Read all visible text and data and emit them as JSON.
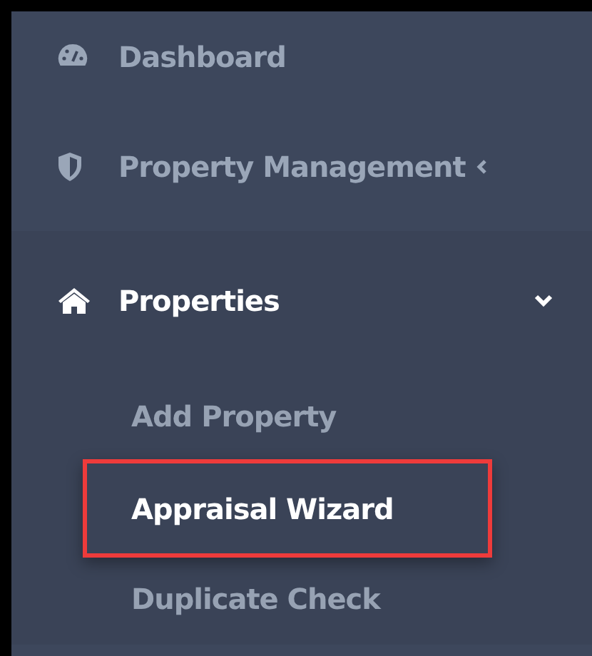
{
  "sidebar": {
    "items": [
      {
        "kind": "link",
        "label": "Dashboard",
        "selected": false
      },
      {
        "kind": "group",
        "label": "Property Management",
        "selected": false,
        "expanded": false
      },
      {
        "kind": "group",
        "label": "Properties",
        "selected": true,
        "expanded": true,
        "children": [
          {
            "label": "Add Property",
            "selected": false,
            "highlighted": false
          },
          {
            "label": "Appraisal Wizard",
            "selected": true,
            "highlighted": true
          },
          {
            "label": "Duplicate Check",
            "selected": false,
            "highlighted": false
          }
        ]
      }
    ]
  }
}
